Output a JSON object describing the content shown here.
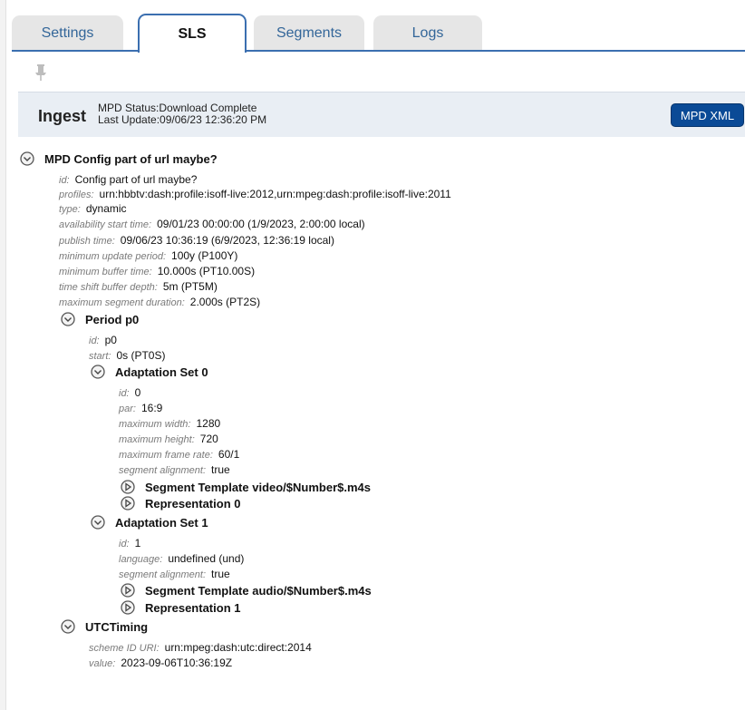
{
  "tabs": [
    {
      "label": "Settings"
    },
    {
      "label": "SLS"
    },
    {
      "label": "Segments"
    },
    {
      "label": "Logs"
    }
  ],
  "header": {
    "title": "Ingest",
    "mpd_status": "MPD Status:Download Complete",
    "last_update": "Last Update:09/06/23 12:36:20 PM",
    "mpd_xml_label": "MPD XML"
  },
  "tree": {
    "mpd": {
      "title": "MPD Config part of url maybe?",
      "props": [
        {
          "key": "id:",
          "value": "Config part of url maybe?"
        },
        {
          "key": "profiles:",
          "value": "urn:hbbtv:dash:profile:isoff-live:2012,urn:mpeg:dash:profile:isoff-live:2011"
        },
        {
          "key": "type:",
          "value": "dynamic"
        },
        {
          "key": "availability start time:",
          "value": "09/01/23 00:00:00 (1/9/2023, 2:00:00 local)"
        },
        {
          "key": "publish time:",
          "value": "09/06/23 10:36:19 (6/9/2023, 12:36:19 local)"
        },
        {
          "key": "minimum update period:",
          "value": "100y (P100Y)"
        },
        {
          "key": "minimum buffer time:",
          "value": "10.000s (PT10.00S)"
        },
        {
          "key": "time shift buffer depth:",
          "value": "5m (PT5M)"
        },
        {
          "key": "maximum segment duration:",
          "value": "2.000s (PT2S)"
        }
      ]
    },
    "period": {
      "title": "Period p0",
      "props": [
        {
          "key": "id:",
          "value": "p0"
        },
        {
          "key": "start:",
          "value": "0s (PT0S)"
        }
      ]
    },
    "adapt0": {
      "title": "Adaptation Set 0",
      "props": [
        {
          "key": "id:",
          "value": "0"
        },
        {
          "key": "par:",
          "value": "16:9"
        },
        {
          "key": "maximum width:",
          "value": "1280"
        },
        {
          "key": "maximum height:",
          "value": "720"
        },
        {
          "key": "maximum frame rate:",
          "value": "60/1"
        },
        {
          "key": "segment alignment:",
          "value": "true"
        }
      ],
      "seg_template": "Segment Template video/$Number$.m4s",
      "representation": "Representation 0"
    },
    "adapt1": {
      "title": "Adaptation Set 1",
      "props": [
        {
          "key": "id:",
          "value": "1"
        },
        {
          "key": "language:",
          "value": "undefined (und)"
        },
        {
          "key": "segment alignment:",
          "value": "true"
        }
      ],
      "seg_template": "Segment Template audio/$Number$.m4s",
      "representation": "Representation 1"
    },
    "utc": {
      "title": "UTCTiming",
      "props": [
        {
          "key": "scheme ID URI:",
          "value": "urn:mpeg:dash:utc:direct:2014"
        },
        {
          "key": "value:",
          "value": "2023-09-06T10:36:19Z"
        }
      ]
    }
  },
  "icons": {
    "pin": "pin-icon",
    "collapse": "collapse-circle-icon",
    "expand": "expand-circle-icon"
  },
  "colors": {
    "accent": "#3b6fb0",
    "button": "#0a4a96",
    "tab_inactive_text": "#336699",
    "header_bg": "#e9eef4"
  }
}
